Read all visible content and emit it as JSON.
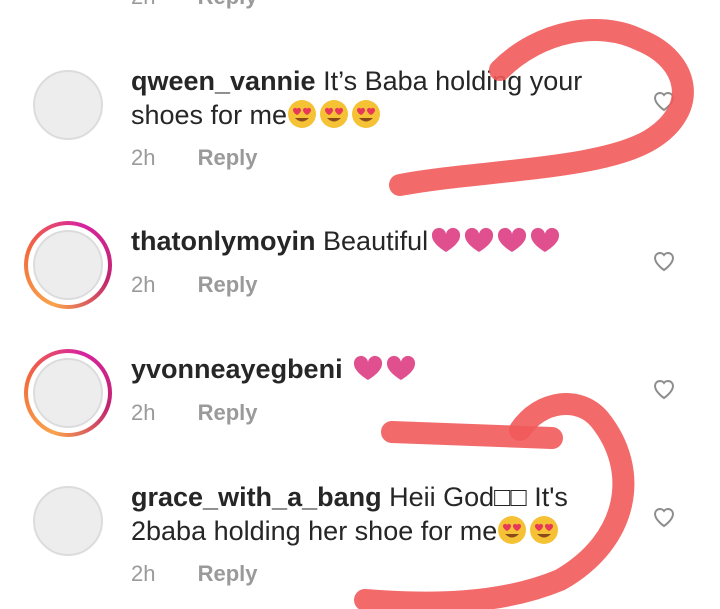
{
  "top_fragment": {
    "time": "2h",
    "reply": "Reply"
  },
  "comments": [
    {
      "username": "qween_vannie",
      "text": "It’s Baba holding your shoes for me",
      "emoji": [
        "smiling-face-with-heart-eyes",
        "smiling-face-with-heart-eyes",
        "smiling-face-with-heart-eyes"
      ],
      "time": "2h",
      "reply": "Reply",
      "has_story_ring": false
    },
    {
      "username": "thatonlymoyin",
      "text": "Beautiful",
      "emoji": [
        "pink-heart",
        "pink-heart",
        "pink-heart",
        "pink-heart"
      ],
      "time": "2h",
      "reply": "Reply",
      "has_story_ring": true
    },
    {
      "username": "yvonneayegbeni",
      "text": "",
      "emoji": [
        "pink-heart",
        "pink-heart"
      ],
      "time": "2h",
      "reply": "Reply",
      "has_story_ring": true
    },
    {
      "username": "grace_with_a_bang",
      "text": "Heii God□□ It's 2baba holding her shoe for me",
      "emoji": [
        "smiling-face-with-heart-eyes",
        "smiling-face-with-heart-eyes"
      ],
      "time": "2h",
      "reply": "Reply",
      "has_story_ring": false
    }
  ],
  "colors": {
    "text": "#262626",
    "meta": "#9a9a9a",
    "scribble": "#f25a5a",
    "pink_heart": "#e0508f",
    "emoji_face": "#f5c236"
  }
}
